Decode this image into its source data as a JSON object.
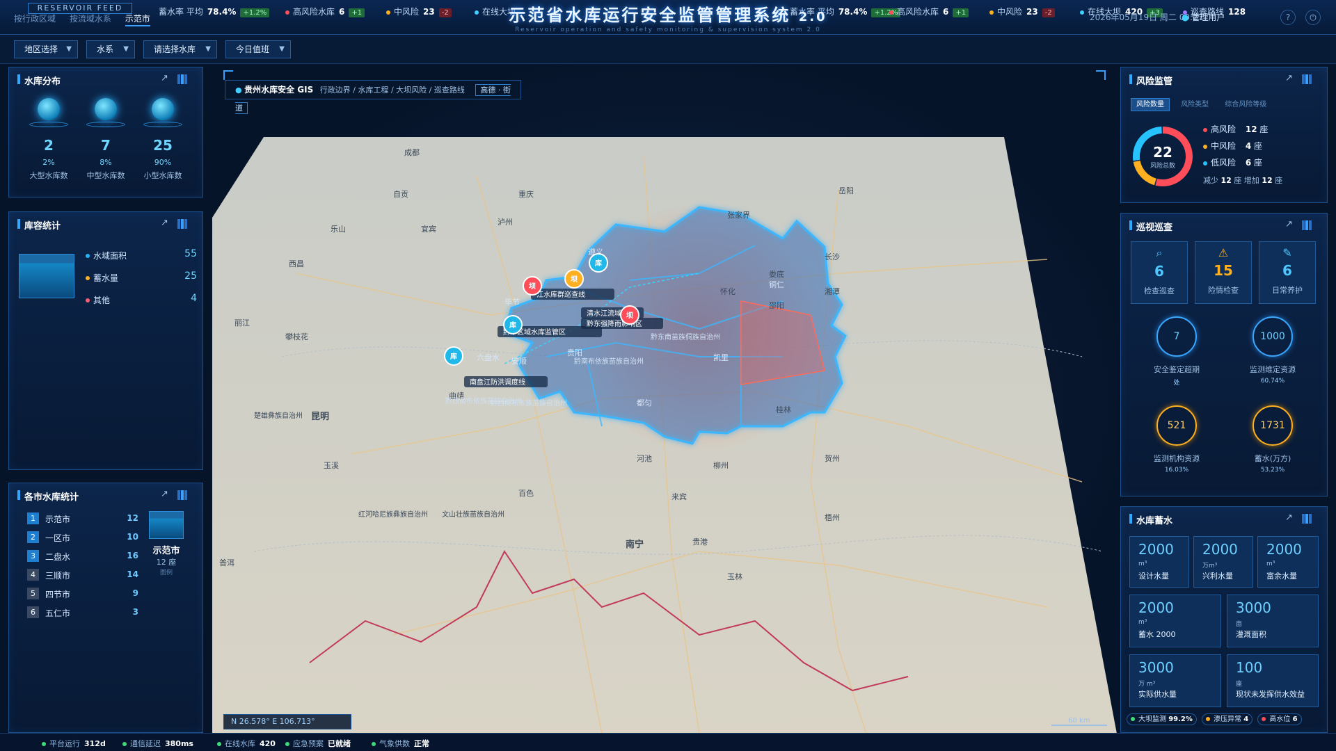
{
  "header": {
    "feed_label": "RESERVOIR FEED",
    "title": "示范省水库运行安全监管管理系统",
    "version": "2.0",
    "subtitle": "Reservoir operation and safety monitoring & supervision system 2.0",
    "nav_tabs": [
      "按行政区域",
      "按流域水系",
      "示范市"
    ],
    "date": "2026年05月19日",
    "weekday": "周二",
    "time": "09:27",
    "user": "管理用户",
    "ticker": [
      {
        "label": "蓄水率 平均",
        "value": "78.4%",
        "delta": "+1.2%",
        "trend": "up",
        "color": "#3fd0ff"
      },
      {
        "label": "高风险水库",
        "value": "6",
        "delta": "+1",
        "trend": "up",
        "color": "#ff4d5a"
      },
      {
        "label": "中风险",
        "value": "23",
        "delta": "-2",
        "trend": "down",
        "color": "#ffb020"
      },
      {
        "label": "在线大坝",
        "value": "420",
        "delta": "+3",
        "trend": "up",
        "color": "#3fd0ff"
      },
      {
        "label": "巡查路线",
        "value": "128",
        "delta": "",
        "trend": "",
        "color": "#a07cff"
      },
      {
        "label": "蓄水率 平均",
        "value": "78.4%",
        "delta": "+1.2%",
        "trend": "up",
        "color": "#3fd0ff"
      },
      {
        "label": "高风险水库",
        "value": "6",
        "delta": "+1",
        "trend": "up",
        "color": "#ff4d5a"
      },
      {
        "label": "中风险",
        "value": "23",
        "delta": "-2",
        "trend": "down",
        "color": "#ffb020"
      },
      {
        "label": "在线大坝",
        "value": "420",
        "delta": "+3",
        "trend": "up",
        "color": "#3fd0ff"
      },
      {
        "label": "巡查路线",
        "value": "128",
        "delta": "",
        "trend": "",
        "color": "#a07cff"
      },
      {
        "label": "示范市",
        "value": "",
        "delta": "",
        "trend": "",
        "color": "#3fd0ff"
      }
    ]
  },
  "filters": [
    "地区选择",
    "水系",
    "请选择水库",
    "今日值班"
  ],
  "reservoir_dist": {
    "title": "水库分布",
    "items": [
      {
        "value": "2",
        "pct": "2%",
        "label": "大型水库数"
      },
      {
        "value": "7",
        "pct": "8%",
        "label": "中型水库数"
      },
      {
        "value": "25",
        "pct": "90%",
        "label": "小型水库数"
      }
    ]
  },
  "capacity": {
    "title": "库容统计",
    "items": [
      {
        "label": "水域面积",
        "value": "55",
        "color": "#27b3ff"
      },
      {
        "label": "蓄水量",
        "value": "25",
        "color": "#ffb020"
      },
      {
        "label": "其他",
        "value": "4",
        "color": "#ff5a6e"
      }
    ]
  },
  "city_stats": {
    "title": "各市水库统计",
    "rows": [
      {
        "no": "1",
        "city": "示范市",
        "value": "12"
      },
      {
        "no": "2",
        "city": "一区市",
        "value": "10"
      },
      {
        "no": "3",
        "city": "二盘水",
        "value": "16"
      },
      {
        "no": "4",
        "city": "三顺市",
        "value": "14"
      },
      {
        "no": "5",
        "city": "四节市",
        "value": "9"
      },
      {
        "no": "6",
        "city": "五仁市",
        "value": "3"
      }
    ],
    "highlight_city": "示范市",
    "highlight_count": "12 座",
    "highlight_note": "图例"
  },
  "map": {
    "title": "贵州水库安全 GIS",
    "layers": "行政边界 / 水库工程 / 大坝风险 / 巡查路线",
    "basemap": "高德 · 街道",
    "coord_n": "N 26.578°",
    "coord_e": "E 106.713°",
    "scale": "60 km",
    "cities": [
      "成都",
      "重庆",
      "昆明",
      "南宁",
      "长沙",
      "贵阳",
      "遵义",
      "毕节",
      "六盘水",
      "安顺",
      "都匀",
      "凯里",
      "铜仁",
      "柳州",
      "桂林",
      "河池",
      "百色",
      "玉溪",
      "曲靖",
      "泸州",
      "宜宾",
      "自贡",
      "乐山",
      "怀化",
      "邵阳",
      "玉林",
      "贵港",
      "来宾",
      "贺州",
      "梧州",
      "普洱",
      "丽江",
      "攀枝花",
      "西昌",
      "张家界",
      "岳阳",
      "湘潭",
      "娄底"
    ],
    "regions": [
      "楚雄彝族自治州",
      "红河哈尼族彝族自治州",
      "文山壮族苗族自治州",
      "黔南布依族苗族自治州",
      "黔西南布依族苗族自治州",
      "黔东南苗族侗族自治州"
    ],
    "markers": [
      {
        "type": "坝",
        "risk": "high"
      },
      {
        "type": "坝",
        "risk": "mid"
      },
      {
        "type": "库",
        "risk": "low"
      },
      {
        "type": "库",
        "risk": "low"
      },
      {
        "type": "库",
        "risk": "low"
      },
      {
        "type": "坝",
        "risk": "high"
      }
    ],
    "labels": [
      "江水库群巡查线",
      "黔中区域水库监管区",
      "黔东强降雨影响区",
      "清水江流域",
      "南盘江防洪调度线",
      "黔西南布依族苗族自治州"
    ]
  },
  "risk": {
    "title": "风险监管",
    "tabs": [
      "风险数量",
      "风险类型",
      "综合风险等级"
    ],
    "total": "22",
    "total_label": "风险总数",
    "chart_data": {
      "type": "pie",
      "categories": [
        "高风险",
        "中风险",
        "低风险"
      ],
      "values": [
        12,
        4,
        6
      ],
      "colors": [
        "#ff4d5a",
        "#ffb020",
        "#27c3ff"
      ]
    },
    "legend": [
      {
        "label": "高风险",
        "value": "12",
        "unit": "座",
        "color": "#ff4d5a"
      },
      {
        "label": "中风险",
        "value": "4",
        "unit": "座",
        "color": "#ffb020"
      },
      {
        "label": "低风险",
        "value": "6",
        "unit": "座",
        "color": "#27c3ff"
      }
    ],
    "decrease_label": "减少",
    "decrease_value": "12",
    "increase_label": "座 增加",
    "increase_value": "12",
    "unit": "座"
  },
  "inspection": {
    "title": "巡视巡查",
    "cards": [
      {
        "icon": "search-icon",
        "value": "6",
        "label": "检查巡查",
        "color": "#4fc8ff"
      },
      {
        "icon": "warning-icon",
        "value": "15",
        "label": "险情检查",
        "color": "#ffb020"
      },
      {
        "icon": "pen-icon",
        "value": "6",
        "label": "日常养护",
        "color": "#4fc8ff"
      }
    ],
    "rings": [
      {
        "value": "7",
        "label": "安全鉴定超期",
        "sub": "处",
        "color": "#3aa8ff"
      },
      {
        "value": "1000",
        "label": "监测维定资源",
        "sub": "60.74%",
        "color": "#3aa8ff"
      },
      {
        "value": "521",
        "label": "监测机构资源",
        "sub": "16.03%",
        "color": "#ffb020"
      },
      {
        "value": "1731",
        "label": "蓄水(万方)",
        "sub": "53.23%",
        "color": "#ffb020"
      }
    ]
  },
  "storage": {
    "title": "水库蓄水",
    "row1": [
      {
        "value": "2000",
        "unit": "m³",
        "label": "设计水量"
      },
      {
        "value": "2000",
        "unit": "万m³",
        "label": "兴利水量"
      },
      {
        "value": "2000",
        "unit": "m³",
        "label": "富余水量"
      }
    ],
    "row2": [
      {
        "value": "2000",
        "unit": "m³",
        "label": "蓄水 2000"
      },
      {
        "value": "3000",
        "unit": "亩",
        "label": "灌溉面积"
      }
    ],
    "row3": [
      {
        "value": "3000",
        "unit": "万 m³",
        "label": "实际供水量"
      },
      {
        "value": "100",
        "unit": "座",
        "label": "现状未发挥供水效益"
      }
    ],
    "badges": [
      {
        "label": "大坝监测",
        "value": "99.2%",
        "color": "#3fdc7a"
      },
      {
        "label": "渗压异常",
        "value": "4",
        "color": "#ffb020"
      },
      {
        "label": "高水位",
        "value": "6",
        "color": "#ff4d5a"
      }
    ]
  },
  "bottom_status": [
    {
      "label": "平台运行",
      "value": "312d",
      "color": "#3fdc7a"
    },
    {
      "label": "通信延迟",
      "value": "380ms",
      "color": "#3fdc7a"
    },
    {
      "label": "在线水库",
      "value": "420",
      "color": "#3fdc7a"
    },
    {
      "label": "应急预案",
      "value": "已就绪",
      "color": "#3fdc7a"
    },
    {
      "label": "气象供数",
      "value": "正常",
      "color": "#3fdc7a"
    }
  ]
}
